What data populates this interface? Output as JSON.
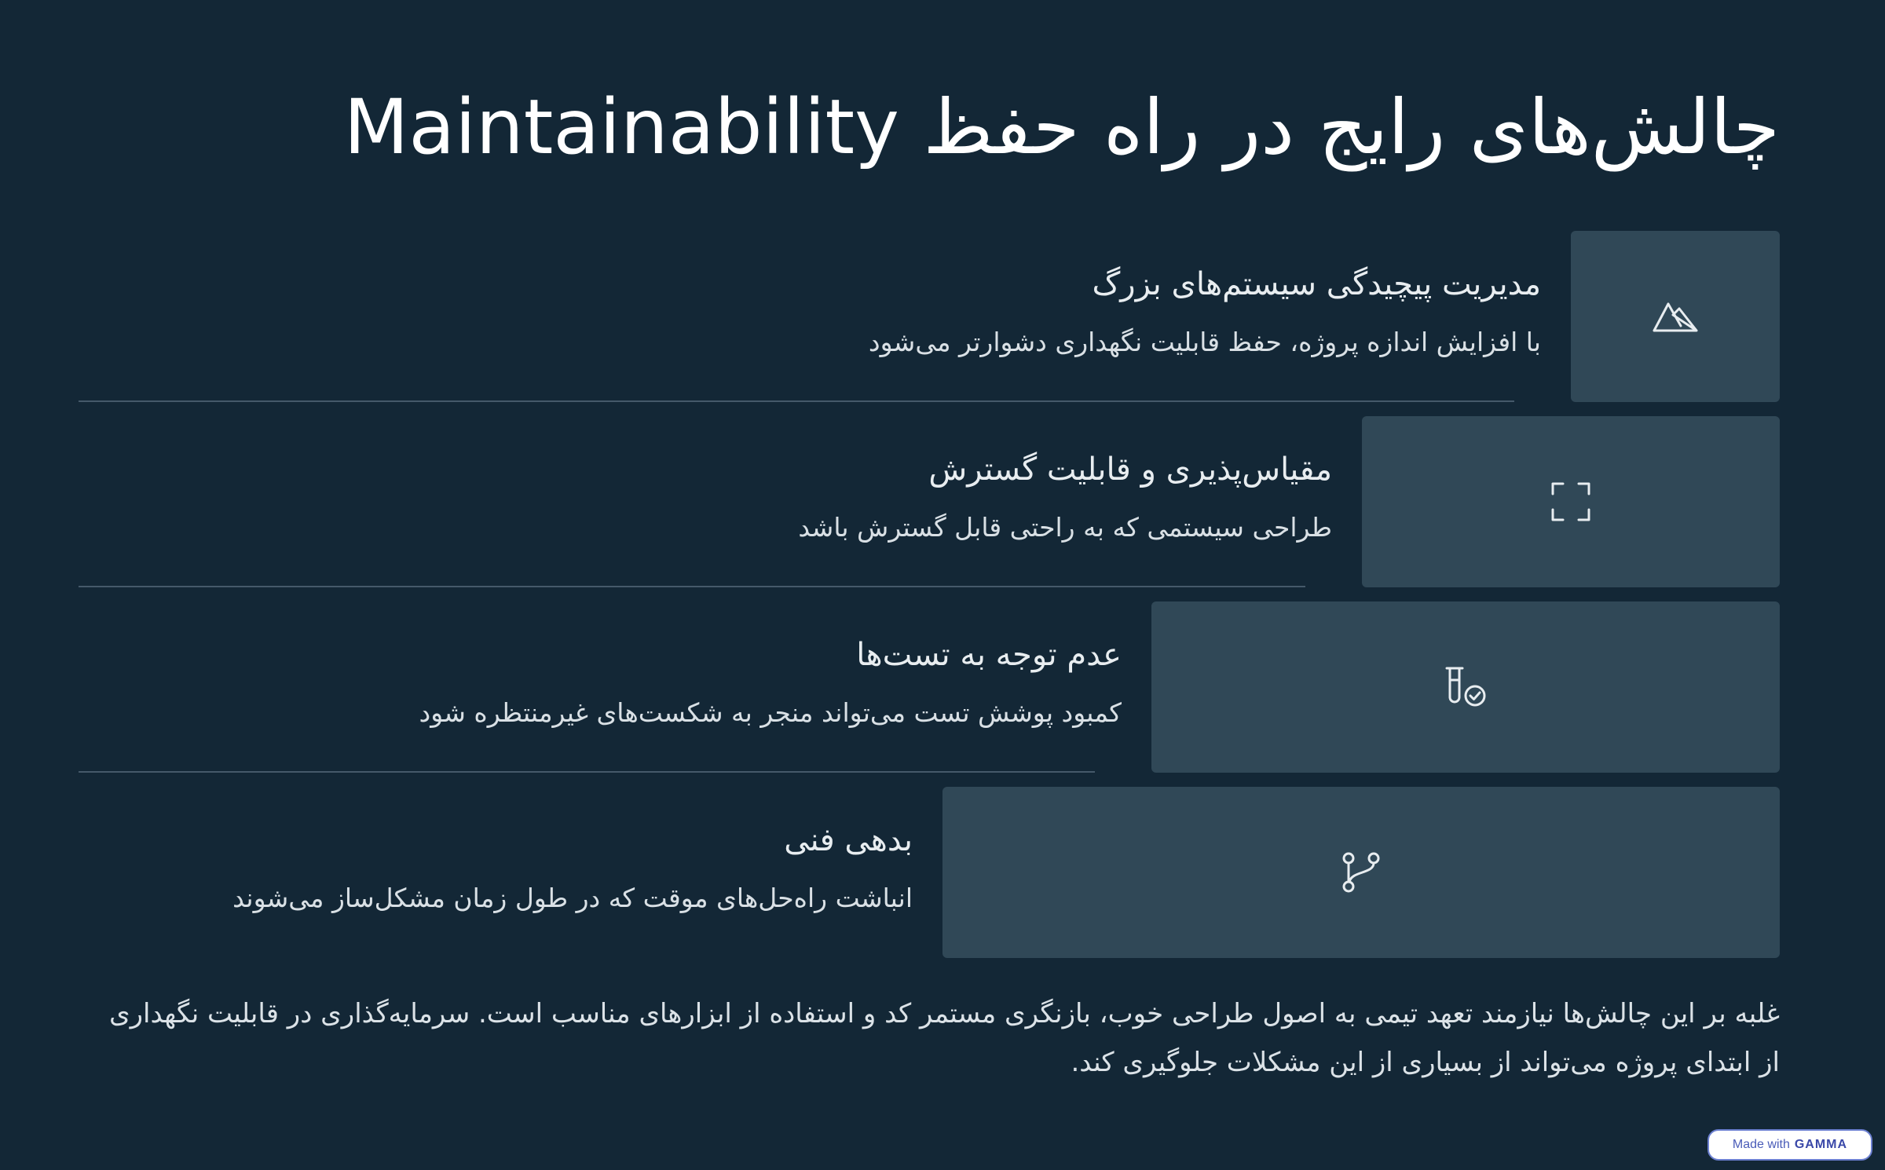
{
  "title": "چالش‌های رایج در راه حفظ Maintainability",
  "challenges": [
    {
      "icon": "mountain-icon",
      "heading": "مدیریت پیچیدگی سیستم‌های بزرگ",
      "description": "با افزایش اندازه پروژه، حفظ قابلیت نگهداری دشوارتر می‌شود"
    },
    {
      "icon": "expand-frame-icon",
      "heading": "مقیاس‌پذیری و قابلیت گسترش",
      "description": "طراحی سیستمی که به راحتی قابل گسترش باشد"
    },
    {
      "icon": "test-tube-check-icon",
      "heading": "عدم توجه به تست‌ها",
      "description": "کمبود پوشش تست می‌تواند منجر به شکست‌های غیرمنتظره شود"
    },
    {
      "icon": "git-branch-icon",
      "heading": "بدهی فنی",
      "description": "انباشت راه‌حل‌های موقت که در طول زمان مشکل‌ساز می‌شوند"
    }
  ],
  "conclusion": "غلبه بر این چالش‌ها نیازمند تعهد تیمی به اصول طراحی خوب، بازنگری مستمر کد و استفاده از ابزارهای مناسب است. سرمایه‌گذاری در قابلیت نگهداری از ابتدای پروژه می‌تواند از بسیاری از این مشکلات جلوگیری کند.",
  "badge": {
    "prefix": "Made with",
    "brand": "GAMMA"
  },
  "colors": {
    "background": "#132736",
    "card": "#304857",
    "divider": "#45596a",
    "text": "#e6ebef"
  }
}
